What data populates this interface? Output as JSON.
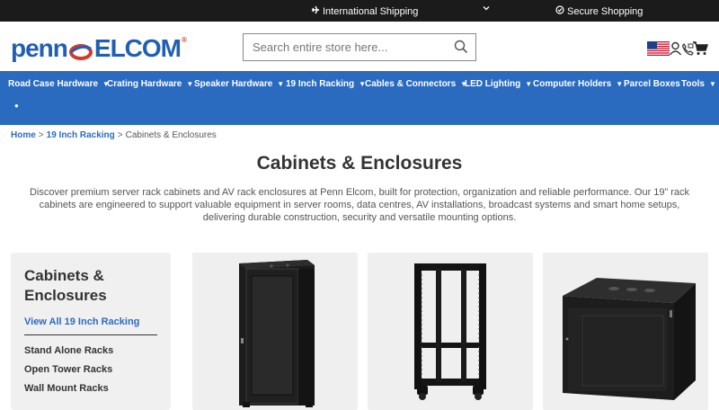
{
  "topbar": {
    "shipping": "International Shipping",
    "secure": "Secure Shopping"
  },
  "header": {
    "logo_left": "penn",
    "logo_right": "elcom",
    "search_placeholder": "Search entire store here..."
  },
  "nav": {
    "items": [
      {
        "label": "Road Case Hardware"
      },
      {
        "label": "Crating Hardware"
      },
      {
        "label": "Speaker Hardware"
      },
      {
        "label": "19 Inch Racking"
      },
      {
        "label": "Cables & Connectors"
      },
      {
        "label": "LED Lighting"
      },
      {
        "label": "Computer Holders"
      },
      {
        "label": "Parcel Boxes"
      },
      {
        "label": "Tools"
      }
    ]
  },
  "breadcrumb": {
    "home": "Home",
    "parent": "19 Inch Racking",
    "current": "Cabinets & Enclosures",
    "separator": ">"
  },
  "page": {
    "title": "Cabinets & Enclosures",
    "intro": "Discover premium server rack cabinets and AV rack enclosures at Penn Elcom, built for protection, organization and reliable performance. Our 19” rack cabinets are engineered to support valuable equipment in server rooms, data centres, AV installations, broadcast systems and smart home setups, delivering durable construction, security and versatile mounting options."
  },
  "sidebar": {
    "heading": "Cabinets & Enclosures",
    "view_all": "View All 19 Inch Racking",
    "links": [
      "Stand Alone Racks",
      "Open Tower Racks",
      "Wall Mount Racks"
    ]
  },
  "colors": {
    "nav_blue": "#2a6bc0",
    "topbar": "#1b1b1b",
    "logo_red": "#d23b2a"
  },
  "icons": [
    "plane-icon",
    "chevron-down-icon",
    "lock-icon",
    "search-icon",
    "us-flag-icon",
    "user-icon",
    "phone-icon",
    "cart-icon"
  ]
}
